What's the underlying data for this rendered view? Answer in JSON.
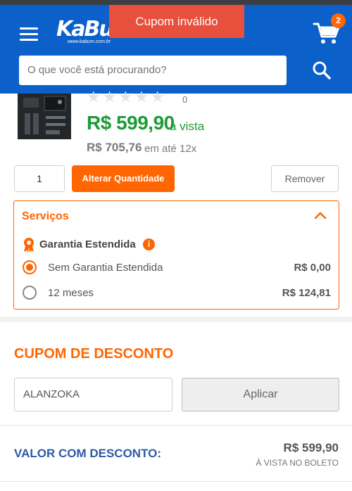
{
  "header": {
    "logo_text": "KaBuM",
    "logo_sub": "www.kabum.com.br",
    "cart_count": "2",
    "search_placeholder": "O que você está procurando?"
  },
  "toast": {
    "message": "Cupom inválido"
  },
  "product": {
    "stars": "★★★★★",
    "rating_count": "0",
    "price": "R$ 599,90",
    "price_suffix": "à vista",
    "price_old": "R$ 705,76",
    "price_old_note": "em até 12x"
  },
  "quantity": {
    "value": "1",
    "alter_label": "Alterar Quantidade",
    "remove_label": "Remover"
  },
  "services": {
    "title": "Serviços",
    "garantia_label": "Garantia Estendida",
    "info_glyph": "i",
    "options": [
      {
        "label": "Sem Garantia Estendida",
        "price": "R$ 0,00",
        "selected": true
      },
      {
        "label": "12 meses",
        "price": "R$ 124,81",
        "selected": false
      }
    ]
  },
  "coupon": {
    "title": "CUPOM DE DESCONTO",
    "value": "ALANZOKA",
    "apply_label": "Aplicar"
  },
  "total": {
    "label": "VALOR COM DESCONTO:",
    "value": "R$ 599,90",
    "note": "À VISTA NO BOLETO"
  },
  "colors": {
    "brand_blue": "#0b60c9",
    "accent_orange": "#ff6500",
    "price_green": "#1d9b36",
    "toast_red": "#e84f3d"
  }
}
